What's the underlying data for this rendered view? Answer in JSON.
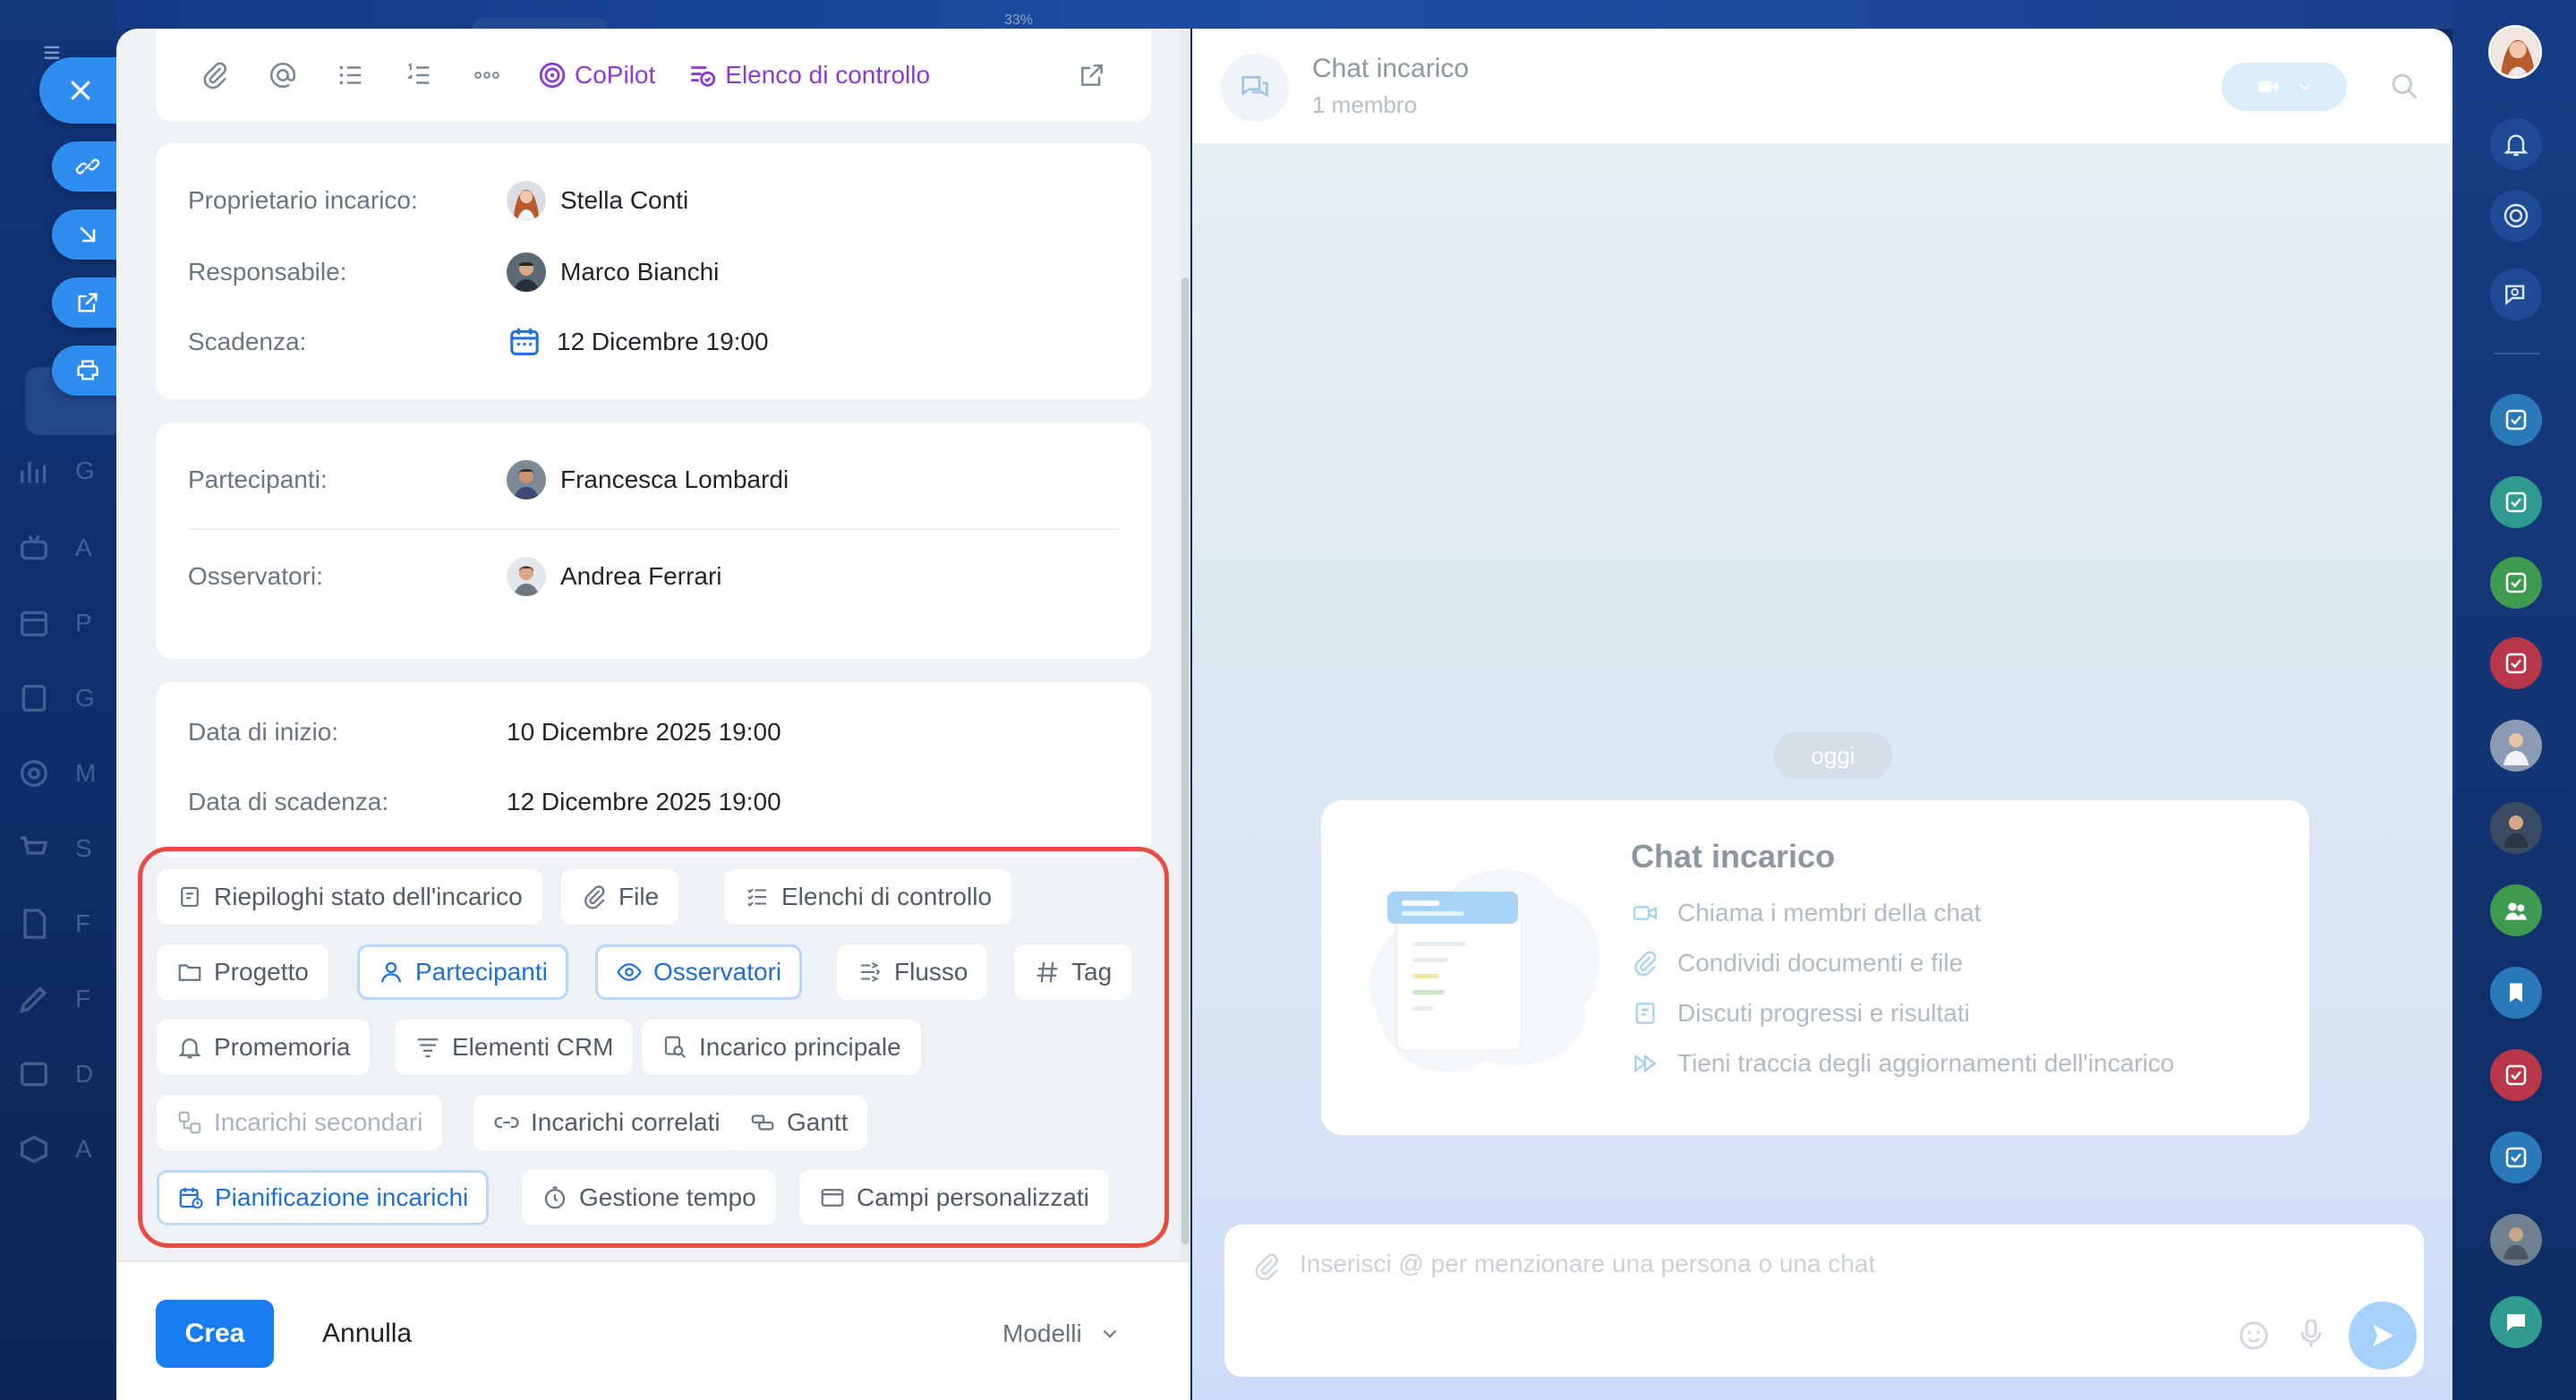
{
  "toolbar": {
    "copilot_label": "CoPilot",
    "checklist_label": "Elenco di controllo"
  },
  "people": {
    "owner_label": "Proprietario incarico:",
    "owner_name": "Stella Conti",
    "responsible_label": "Responsabile:",
    "responsible_name": "Marco Bianchi",
    "deadline_label": "Scadenza:",
    "deadline_value": "12 Dicembre 19:00"
  },
  "members": {
    "participants_label": "Partecipanti:",
    "participants_name": "Francesca Lombardi",
    "observers_label": "Osservatori:",
    "observers_name": "Andrea Ferrari"
  },
  "dates": {
    "start_label": "Data di inizio:",
    "start_value": "10 Dicembre 2025 19:00",
    "due_label": "Data di scadenza:",
    "due_value": "12 Dicembre 2025 19:00"
  },
  "chips": {
    "riepiloghi": "Riepiloghi stato dell'incarico",
    "file": "File",
    "elenchi": "Elenchi di controllo",
    "progetto": "Progetto",
    "partecipanti": "Partecipanti",
    "osservatori": "Osservatori",
    "flusso": "Flusso",
    "tag": "Tag",
    "promemoria": "Promemoria",
    "crm": "Elementi CRM",
    "principale": "Incarico principale",
    "secondari": "Incarichi secondari",
    "correlati": "Incarichi correlati",
    "gantt": "Gantt",
    "pianificazione": "Pianificazione incarichi",
    "tempo": "Gestione tempo",
    "campi": "Campi personalizzati"
  },
  "footer": {
    "create_label": "Crea",
    "cancel_label": "Annulla",
    "templates_label": "Modelli"
  },
  "chat": {
    "title": "Chat incarico",
    "members": "1 membro",
    "date_badge": "oggi",
    "card_title": "Chat incarico",
    "features": [
      "Chiama i membri della chat",
      "Condividi documenti e file",
      "Discuti progressi e risultati",
      "Tieni traccia degli aggiornamenti dell'incarico"
    ],
    "composer_placeholder": "Inserisci @ per menzionare una persona o una chat"
  },
  "background": {
    "zoom_text": "33%",
    "nav_initials": [
      "G",
      "A",
      "P",
      "G",
      "M",
      "S",
      "F",
      "F",
      "D",
      "A"
    ]
  },
  "colors": {
    "accent": "#1a7cf2",
    "copilot": "#8a3bd6",
    "highlight_border": "#e84b43",
    "chip_selected": "#1f6fd6"
  }
}
